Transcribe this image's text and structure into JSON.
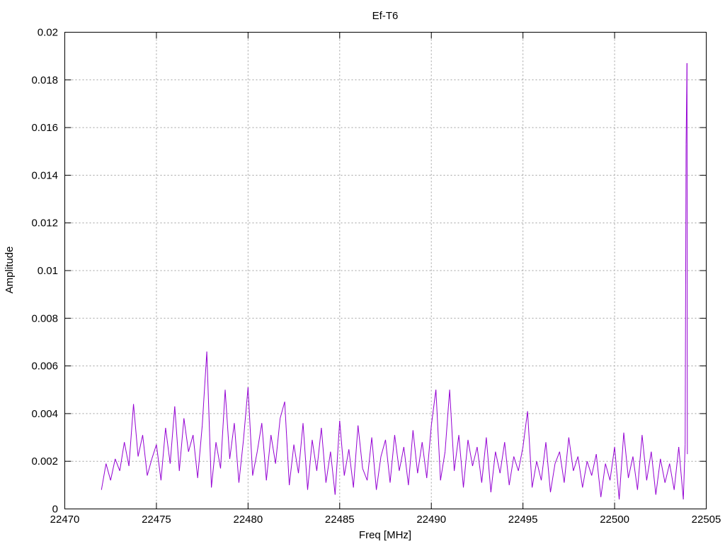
{
  "chart_data": {
    "type": "line",
    "title": "Ef-T6",
    "xlabel": "Freq [MHz]",
    "ylabel": "Amplitude",
    "xlim": [
      22470,
      22505
    ],
    "ylim": [
      0,
      0.02
    ],
    "grid": true,
    "legend": "none",
    "x_ticks": [
      "22470",
      "22475",
      "22480",
      "22485",
      "22490",
      "22495",
      "22500",
      "22505"
    ],
    "y_ticks": [
      "0",
      "0.002",
      "0.004",
      "0.006",
      "0.008",
      "0.01",
      "0.012",
      "0.014",
      "0.016",
      "0.018",
      "0.02"
    ],
    "series": [
      {
        "name": "Ef-T6",
        "color": "#9400d3",
        "x_start": 22472,
        "x_step": 0.25,
        "values": [
          0.0008,
          0.0019,
          0.0012,
          0.0021,
          0.0016,
          0.0028,
          0.0018,
          0.0044,
          0.0022,
          0.0031,
          0.0014,
          0.0021,
          0.0027,
          0.0012,
          0.0034,
          0.0019,
          0.0043,
          0.0016,
          0.0038,
          0.0024,
          0.0031,
          0.0013,
          0.0035,
          0.0066,
          0.0009,
          0.0028,
          0.0017,
          0.005,
          0.0021,
          0.0036,
          0.0011,
          0.0029,
          0.0051,
          0.0014,
          0.0024,
          0.0036,
          0.0012,
          0.0031,
          0.0019,
          0.0038,
          0.0045,
          0.001,
          0.0027,
          0.0015,
          0.0036,
          0.0008,
          0.0029,
          0.0016,
          0.0034,
          0.0011,
          0.0024,
          0.0006,
          0.0037,
          0.0014,
          0.0025,
          0.0009,
          0.0035,
          0.0017,
          0.0012,
          0.003,
          0.0008,
          0.0022,
          0.0029,
          0.0011,
          0.0031,
          0.0016,
          0.0026,
          0.001,
          0.0033,
          0.0015,
          0.0028,
          0.0013,
          0.0035,
          0.005,
          0.0012,
          0.0024,
          0.005,
          0.0016,
          0.0031,
          0.0009,
          0.0029,
          0.0018,
          0.0026,
          0.0011,
          0.003,
          0.0007,
          0.0024,
          0.0015,
          0.0028,
          0.001,
          0.0022,
          0.0016,
          0.0026,
          0.0041,
          0.0009,
          0.002,
          0.0012,
          0.0028,
          0.0007,
          0.0019,
          0.0024,
          0.0011,
          0.003,
          0.0016,
          0.0022,
          0.0009,
          0.002,
          0.0014,
          0.0023,
          0.0005,
          0.0019,
          0.0012,
          0.0026,
          0.0004,
          0.0032,
          0.0013,
          0.0022,
          0.0008,
          0.0031,
          0.0012,
          0.0024,
          0.0006,
          0.0021,
          0.0011,
          0.0019,
          0.0008,
          0.0026,
          0.0004
        ],
        "extra_points": [
          [
            22503.85,
            0.0027
          ],
          [
            22503.9,
            0.0153
          ],
          [
            22503.95,
            0.0187
          ],
          [
            22503.97,
            0.0023
          ]
        ]
      }
    ]
  }
}
